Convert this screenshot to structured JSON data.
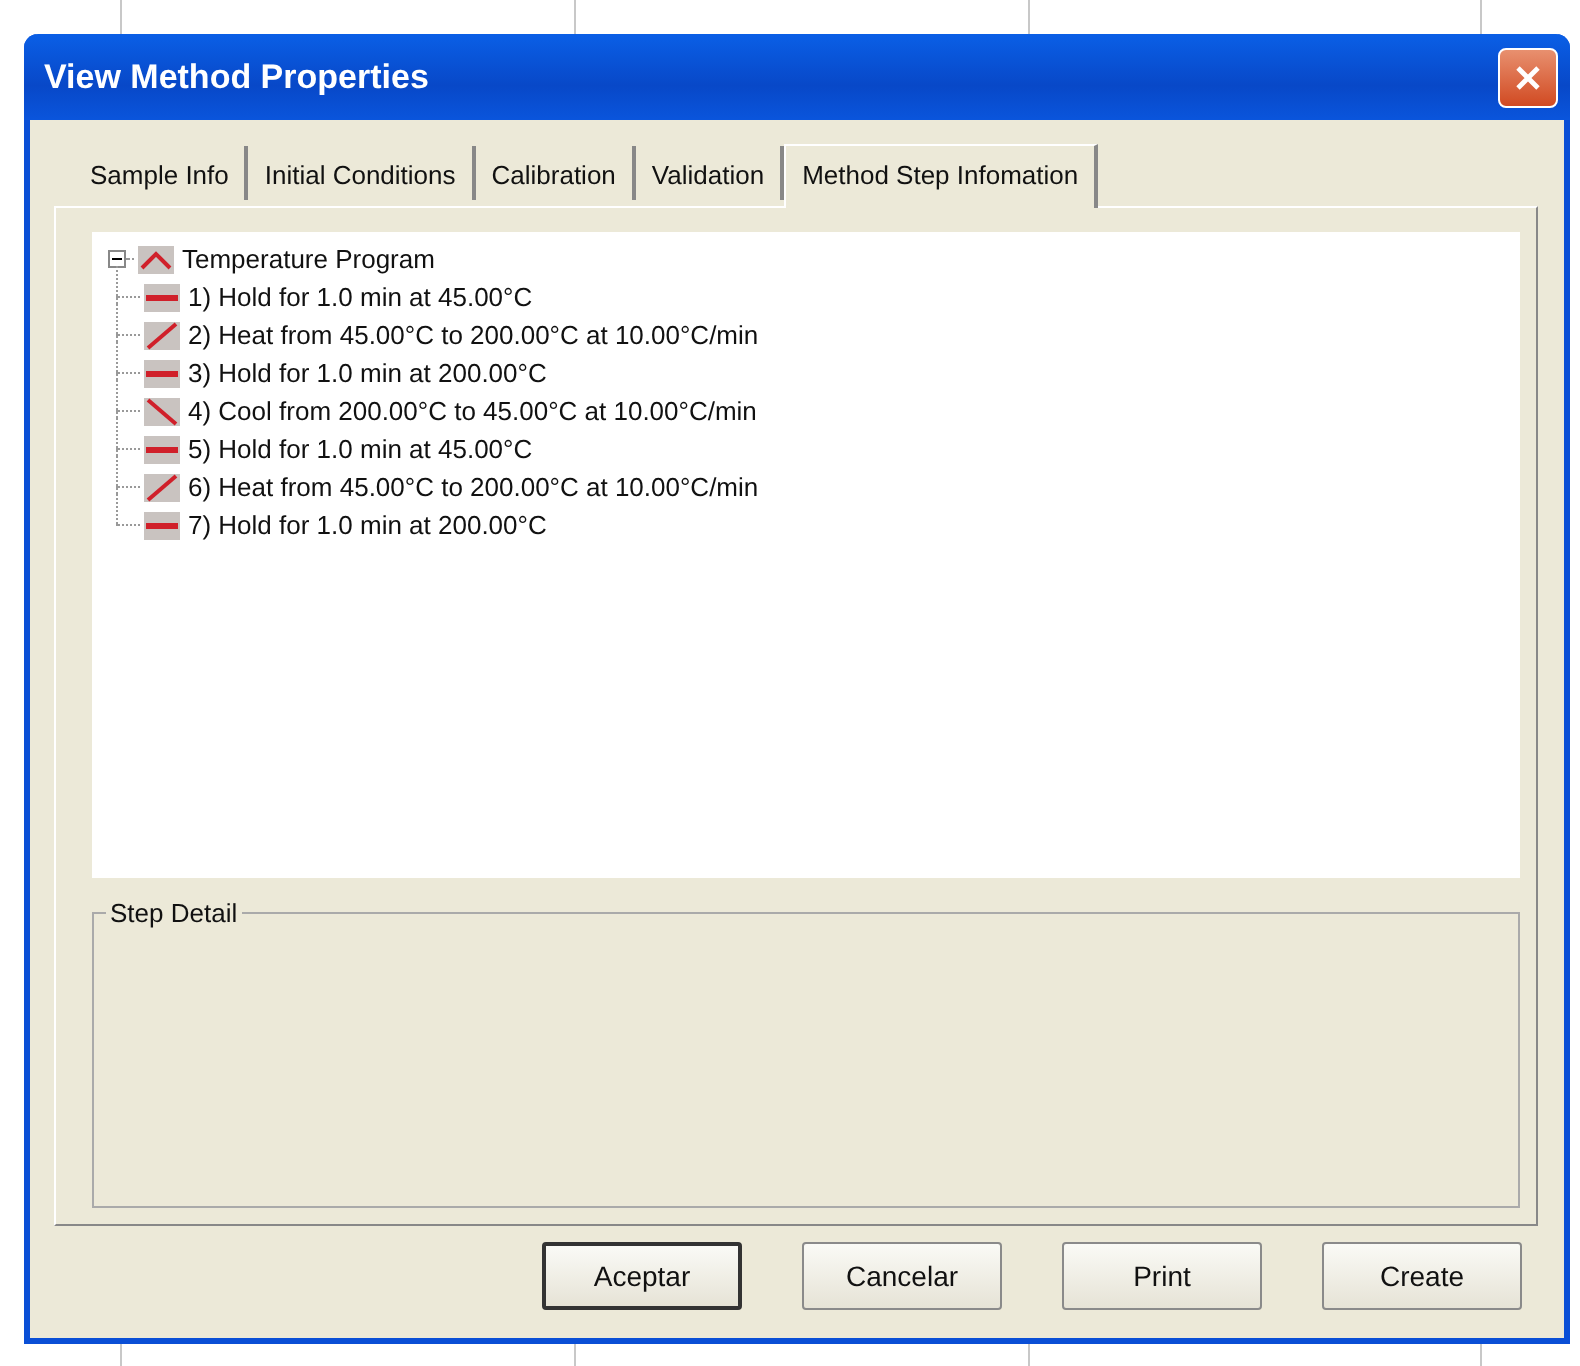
{
  "window": {
    "title": "View Method Properties"
  },
  "tabs": [
    {
      "label": "Sample Info",
      "selected": false
    },
    {
      "label": "Initial Conditions",
      "selected": false
    },
    {
      "label": "Calibration",
      "selected": false
    },
    {
      "label": "Validation",
      "selected": false
    },
    {
      "label": "Method Step Infomation",
      "selected": true
    }
  ],
  "tree": {
    "label": "Temperature Program",
    "expanded": true,
    "children": [
      {
        "kind": "hold",
        "label": "1) Hold for 1.0 min at 45.00°C"
      },
      {
        "kind": "heat",
        "label": "2) Heat from 45.00°C to 200.00°C at 10.00°C/min"
      },
      {
        "kind": "hold",
        "label": "3) Hold for 1.0 min at 200.00°C"
      },
      {
        "kind": "cool",
        "label": "4) Cool from 200.00°C to 45.00°C at 10.00°C/min"
      },
      {
        "kind": "hold",
        "label": "5) Hold for 1.0 min at 45.00°C"
      },
      {
        "kind": "heat",
        "label": "6) Heat from 45.00°C to 200.00°C at 10.00°C/min"
      },
      {
        "kind": "hold",
        "label": "7) Hold for 1.0 min at 200.00°C"
      }
    ]
  },
  "step_detail": {
    "title": "Step Detail"
  },
  "buttons": [
    {
      "label": "Aceptar",
      "default": true
    },
    {
      "label": "Cancelar",
      "default": false
    },
    {
      "label": "Print",
      "default": false
    },
    {
      "label": "Create",
      "default": false
    }
  ]
}
